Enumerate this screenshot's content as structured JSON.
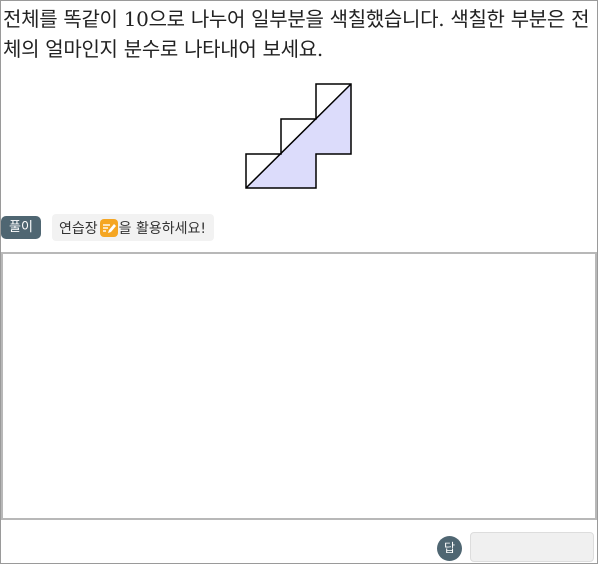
{
  "question": {
    "text": "전체를 똑같이 10으로 나누어 일부분을 색칠했습니다. 색칠한 부분은 전체의 얼마인지 분수로 나타내어 보세요."
  },
  "figure": {
    "fill_color": "#dcdcfb",
    "stroke_color": "#000000",
    "icon": "staircase-shape-half-shaded"
  },
  "solution": {
    "badge": "풀이",
    "hint_before": "연습장",
    "hint_icon": "pencil-icon",
    "hint_after": "을 활용하세요!"
  },
  "answer": {
    "badge": "답",
    "value": "",
    "placeholder": ""
  },
  "colors": {
    "badge_bg": "#4f6672",
    "pencil_icon_bg": "#f5a623",
    "hint_bg": "#f2f2f2",
    "workpad_border": "#b8b8b8"
  }
}
